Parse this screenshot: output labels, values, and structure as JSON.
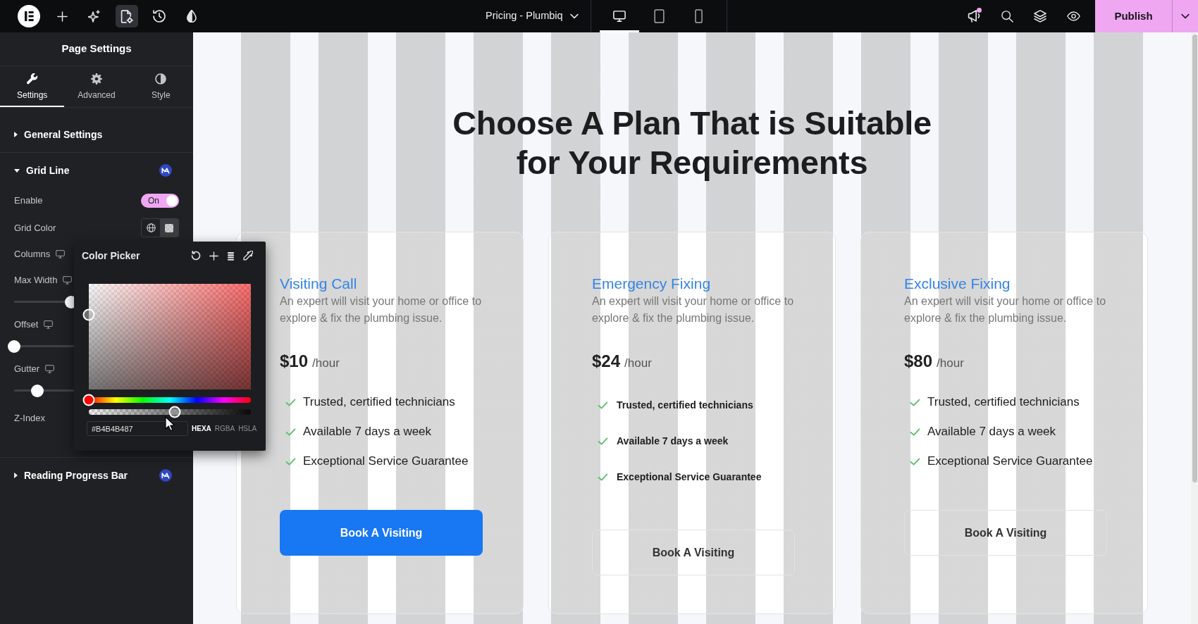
{
  "top_bar": {
    "tools": [
      {
        "selected": false
      },
      {
        "selected": false
      },
      {
        "selected": true
      },
      {
        "selected": false
      },
      {
        "selected": false
      }
    ],
    "document_title": "Pricing - Plumbiq",
    "devices": [
      {
        "selected": true
      },
      {
        "selected": false
      },
      {
        "selected": false
      }
    ],
    "announcements_unread": true,
    "publish": {
      "label": "Publish"
    }
  },
  "panel": {
    "title": "Page Settings",
    "tabs": [
      {
        "label": "Settings",
        "selected": true
      },
      {
        "label": "Advanced",
        "selected": false
      },
      {
        "label": "Style",
        "selected": false
      }
    ],
    "sections": [
      {
        "title": "General Settings",
        "expanded": false,
        "badge": false
      },
      {
        "title": "Grid Line",
        "expanded": true,
        "badge": true,
        "controls": [
          {
            "kind": "switch",
            "label": "Enable",
            "on": true,
            "text": "On"
          },
          {
            "kind": "color",
            "label": "Grid Color"
          },
          {
            "kind": "number",
            "label": "Columns",
            "responsive": true
          },
          {
            "kind": "slider",
            "label": "Max Width",
            "responsive": true,
            "level": 0.49
          },
          {
            "kind": "slider",
            "label": "Offset",
            "responsive": true,
            "level": 0
          },
          {
            "kind": "slider",
            "label": "Gutter",
            "responsive": true,
            "level": 0.2
          },
          {
            "kind": "number",
            "label": "Z-Index",
            "responsive": false
          }
        ]
      },
      {
        "title": "Reading Progress Bar",
        "expanded": false,
        "badge": true
      }
    ]
  },
  "color_picker": {
    "title": "Color Picker",
    "hue_slider": {
      "level": 0
    },
    "alpha_slider": {
      "level": 0.53
    },
    "value": "#B4B4B487",
    "formats": [
      {
        "label": "HEXA",
        "selected": true
      },
      {
        "label": "RGBA",
        "selected": false
      },
      {
        "label": "HSLA",
        "selected": false
      }
    ]
  },
  "page": {
    "heading": "Choose A Plan That is Suitable for Your Requirements",
    "plans": [
      {
        "kind": "regular",
        "title": "Visiting Call",
        "description": "An expert will visit your home or office to explore & fix the plumbing issue.",
        "price": "$10",
        "unit": "/hour",
        "features": [
          "Trusted, certified technicians",
          "Available 7 days a week",
          "Exceptional Service Guarantee"
        ],
        "button": {
          "label": "Book A Visiting",
          "kind": "filled"
        }
      },
      {
        "kind": "compact",
        "title": "Emergency Fixing",
        "description": "An expert will visit your home or office to explore & fix the plumbing issue.",
        "price": "$24",
        "unit": "/hour",
        "features": [
          "Trusted, certified technicians",
          "Available 7 days a week",
          "Exceptional Service Guarantee"
        ],
        "button": {
          "label": "Book A Visiting",
          "kind": "outline"
        }
      },
      {
        "kind": "regular",
        "title": "Exclusive Fixing",
        "description": "An expert will visit your home or office to explore & fix the plumbing issue.",
        "price": "$80",
        "unit": "/hour",
        "features": [
          "Trusted, certified technicians",
          "Available 7 days a week",
          "Exceptional Service Guarantee"
        ],
        "button": {
          "label": "Book A Visiting",
          "kind": "outline"
        }
      }
    ]
  }
}
